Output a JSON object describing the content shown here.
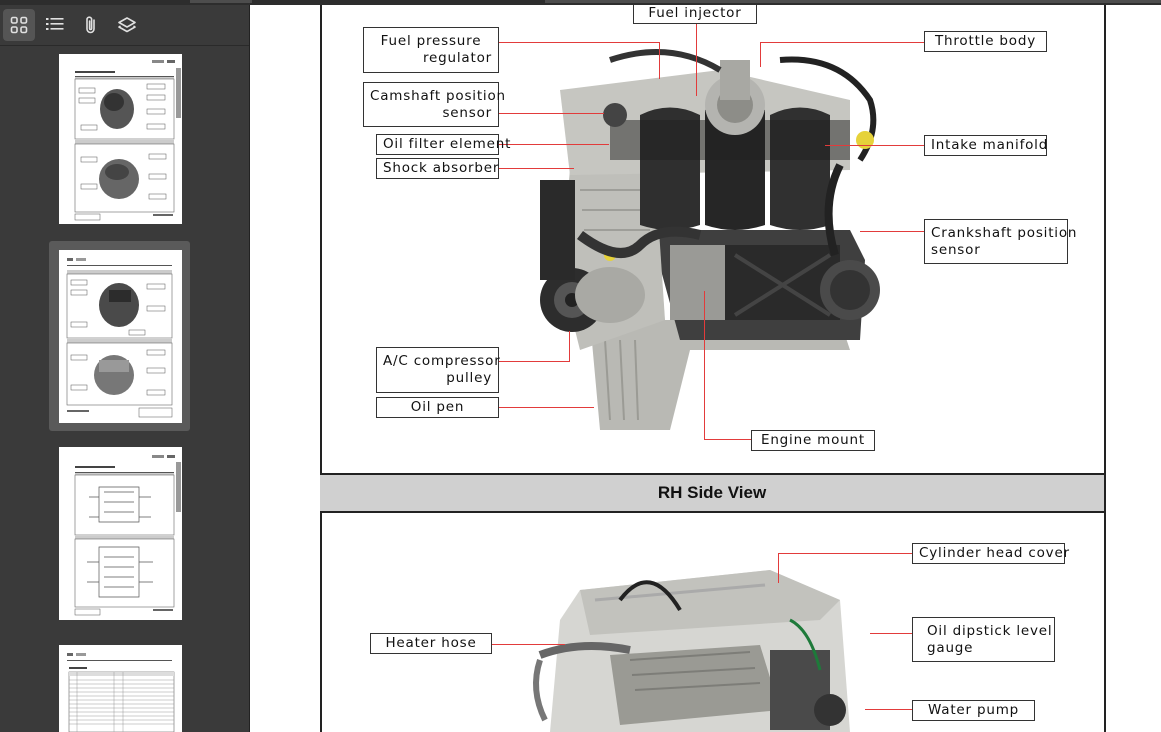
{
  "toolbar": {
    "buttons": [
      {
        "name": "thumbnails-icon",
        "active": true
      },
      {
        "name": "outline-icon",
        "active": false
      },
      {
        "name": "attachments-icon",
        "active": false
      },
      {
        "name": "layers-icon",
        "active": false
      }
    ]
  },
  "thumbnails": {
    "selected_index": 1,
    "count_visible": 4
  },
  "document": {
    "lh_labels": {
      "fuel_injector": "Fuel injector",
      "throttle_body": "Throttle body",
      "fuel_pressure_regulator_1": "Fuel pressure",
      "fuel_pressure_regulator_2": "regulator",
      "camshaft_1": "Camshaft position",
      "camshaft_2": "sensor",
      "oil_filter": "Oil filter element",
      "shock_absorber": "Shock absorber",
      "intake_manifold": "Intake manifold",
      "crankshaft_1": "Crankshaft position",
      "crankshaft_2": "sensor",
      "ac_compressor_1": "A/C compressor",
      "ac_compressor_2": "pulley",
      "oil_pen": "Oil pen",
      "engine_mount": "Engine mount"
    },
    "rh_section_title": "RH Side View",
    "rh_labels": {
      "cylinder_head_cover": "Cylinder head cover",
      "heater_hose": "Heater hose",
      "oil_dipstick_1": "Oil dipstick level",
      "oil_dipstick_2": "gauge",
      "water_pump": "Water pump"
    },
    "colors": {
      "leader_line": "#e23b3b",
      "section_band": "#d0d0d0"
    }
  }
}
